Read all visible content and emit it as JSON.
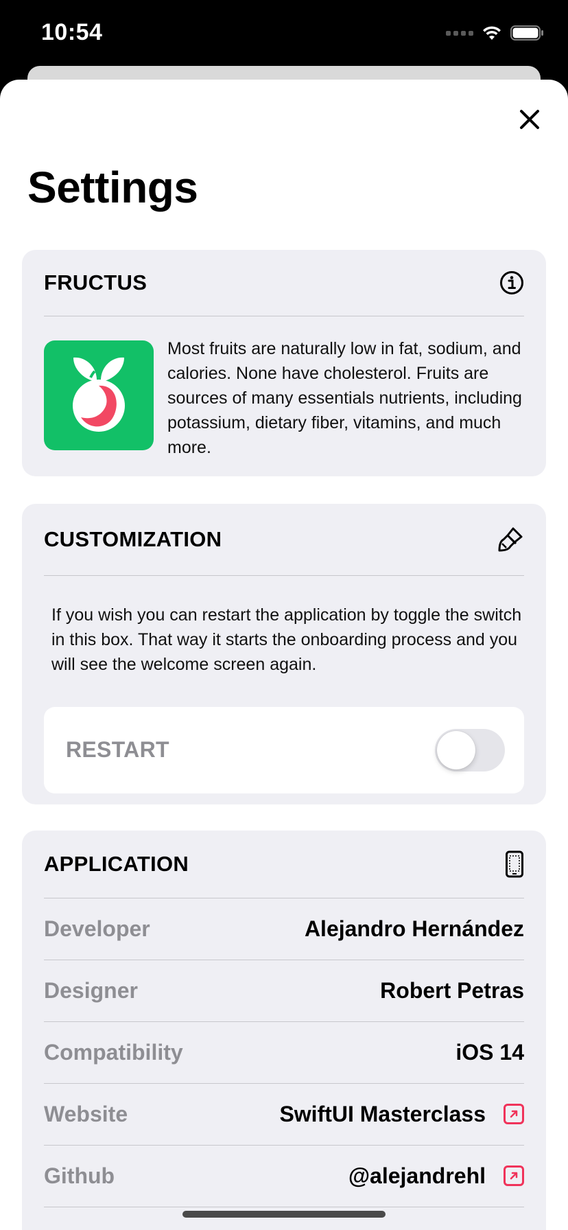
{
  "status_bar": {
    "time": "10:54"
  },
  "sheet": {
    "title": "Settings"
  },
  "fructus": {
    "title": "FRUCTUS",
    "icon": "info-circle-icon",
    "description": "Most fruits are naturally low in fat, sodium, and calories. None have cholesterol. Fruits are sources of many essentials nutrients, including potassium, dietary fiber, vitamins, and much more."
  },
  "customization": {
    "title": "CUSTOMIZATION",
    "icon": "paintbrush-icon",
    "description": "If you wish you can restart the application by toggle the switch in this box. That way it starts the onboarding process and you will see the welcome screen again.",
    "restart_label": "RESTART",
    "restart_on": false
  },
  "application": {
    "title": "APPLICATION",
    "icon": "iphone-icon",
    "rows": [
      {
        "label": "Developer",
        "value": "Alejandro Hernández",
        "link": false
      },
      {
        "label": "Designer",
        "value": "Robert Petras",
        "link": false
      },
      {
        "label": "Compatibility",
        "value": "iOS 14",
        "link": false
      },
      {
        "label": "Website",
        "value": "SwiftUI Masterclass",
        "link": true
      },
      {
        "label": "Github",
        "value": "@alejandrehl",
        "link": true
      }
    ]
  },
  "colors": {
    "accent": "#f0335a",
    "logo_bg": "#12c067",
    "card_bg": "#efeff4"
  }
}
